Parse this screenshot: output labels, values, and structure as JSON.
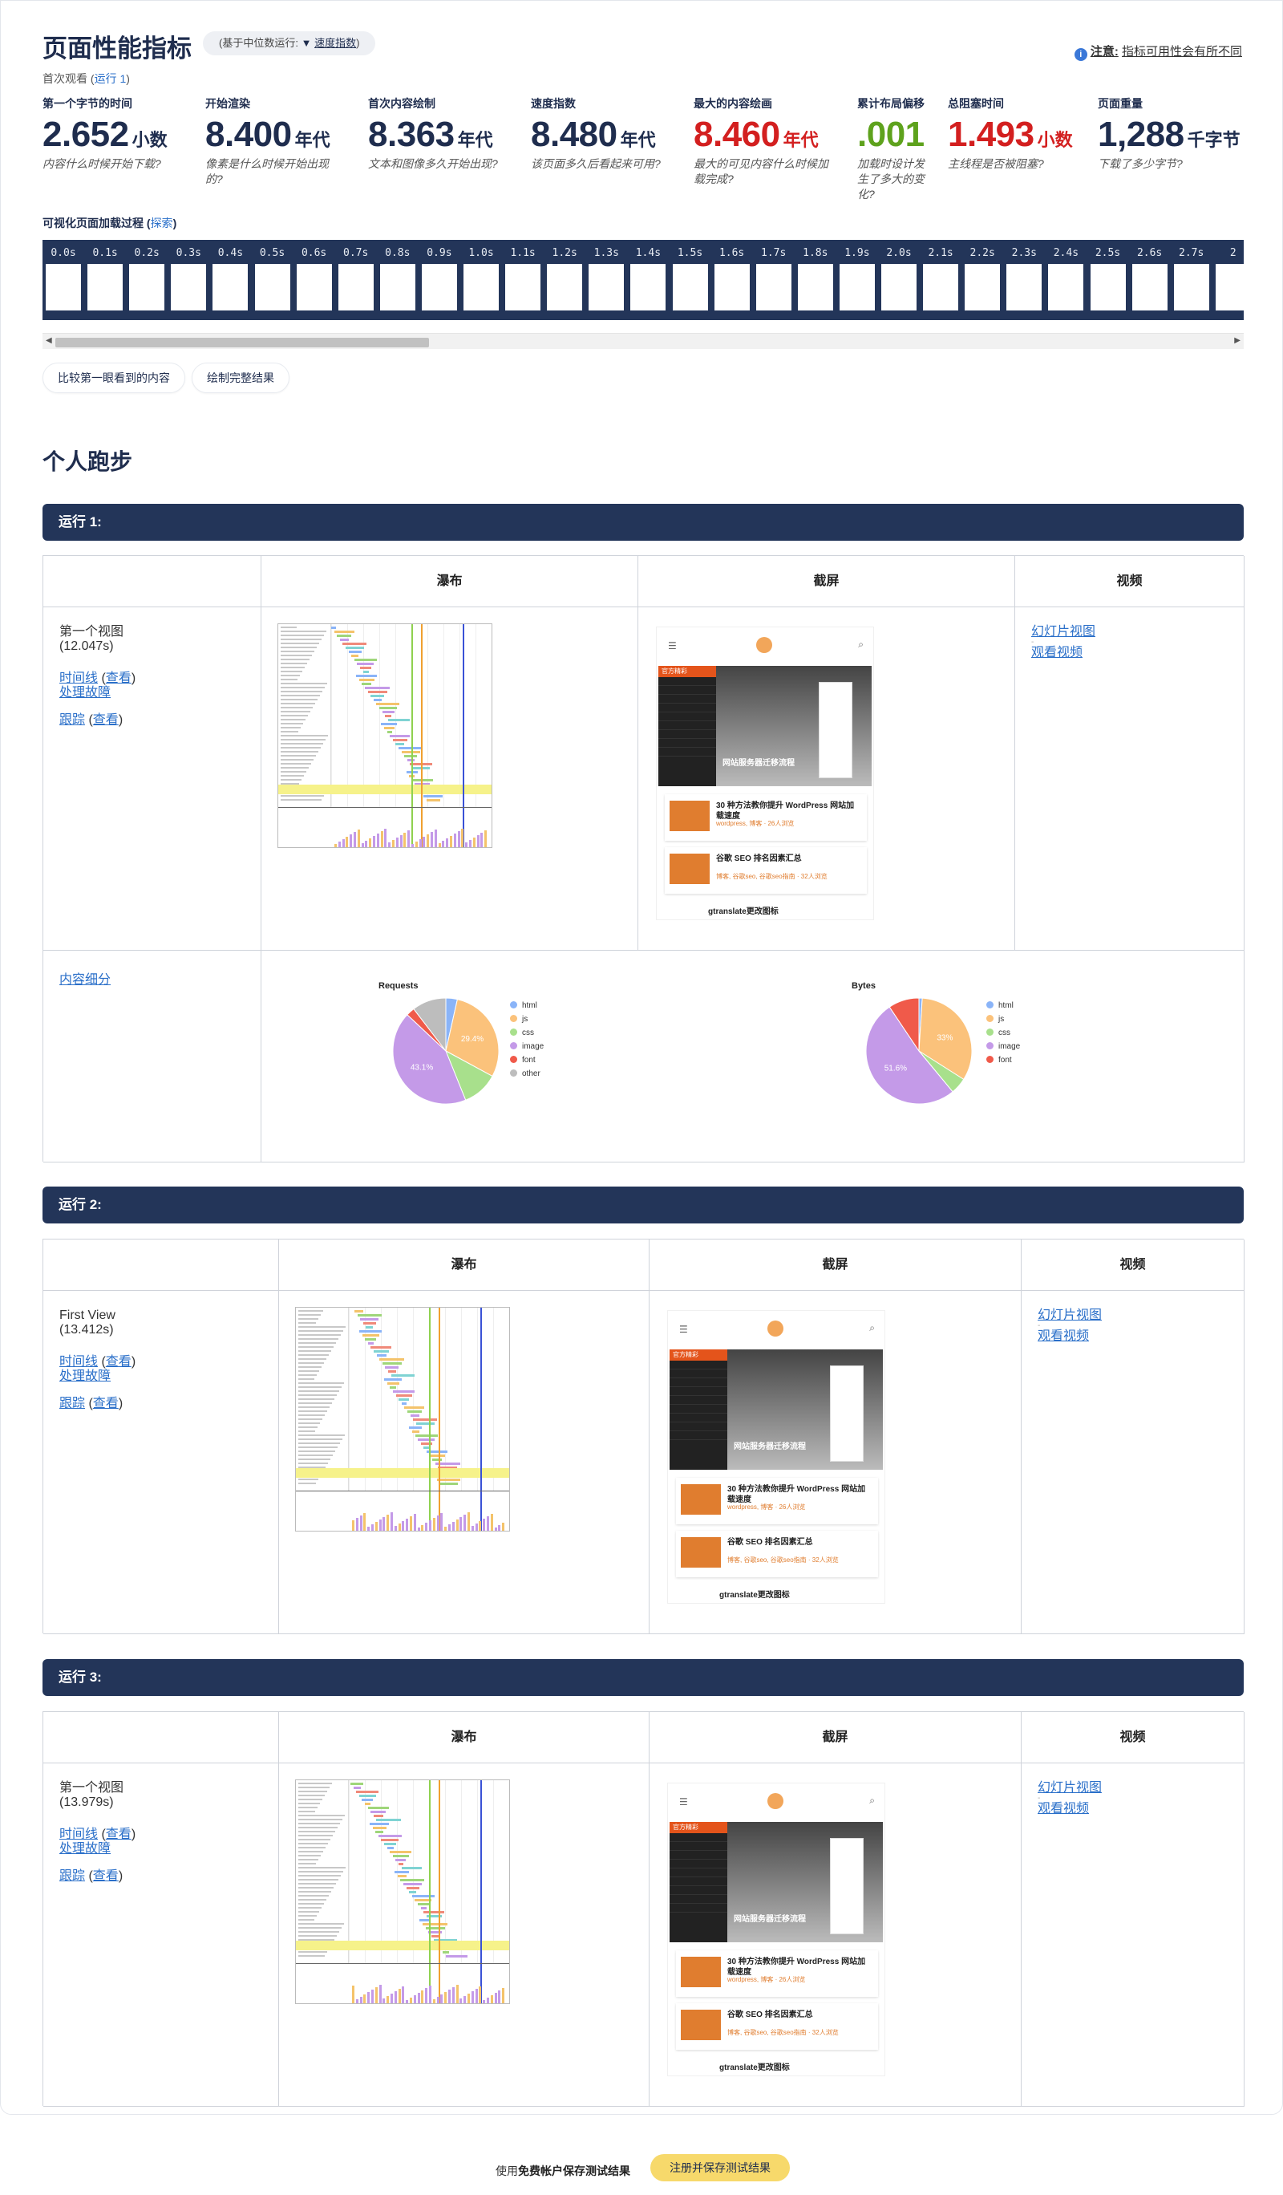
{
  "header": {
    "title": "页面性能指标",
    "median_prefix": "(基于中位数运行:",
    "median_caret": "▼",
    "median_value": "速度指数",
    "median_suffix": ")",
    "notice_icon": "info-icon",
    "notice_label": "注意:",
    "notice_text": "指标可用性会有所不同",
    "first_view_label": "首次观看",
    "first_view_run_open": "(",
    "first_view_run": "运行 1",
    "first_view_run_close": ")"
  },
  "metrics": [
    {
      "label": "第一个字节的时间",
      "value": "2.652",
      "unit": "小数",
      "desc": "内容什么时候开始下载?",
      "color": "#1f2d4e"
    },
    {
      "label": "开始渲染",
      "value": "8.400",
      "unit": "年代",
      "desc": "像素是什么时候开始出现的?",
      "color": "#1f2d4e"
    },
    {
      "label": "首次内容绘制",
      "value": "8.363",
      "unit": "年代",
      "desc": "文本和图像多久开始出现?",
      "color": "#1f2d4e"
    },
    {
      "label": "速度指数",
      "value": "8.480",
      "unit": "年代",
      "desc": "该页面多久后看起来可用?",
      "color": "#1f2d4e"
    },
    {
      "label": "最大的内容绘画",
      "value": "8.460",
      "unit": "年代",
      "desc": "最大的可见内容什么时候加载完成?",
      "color": "#d31f1f"
    },
    {
      "label": "累计布局偏移",
      "value": ".001",
      "unit": "",
      "desc": "加载时设计发生了多大的变化?",
      "color": "#5ea21d"
    },
    {
      "label": "总阻塞时间",
      "value": "1.493",
      "unit": "小数",
      "desc": "主线程是否被阻塞?",
      "color": "#d31f1f"
    },
    {
      "label": "页面重量",
      "value": "1,288",
      "unit": "千字节",
      "desc": "下载了多少字节?",
      "color": "#1f2d4e"
    }
  ],
  "filmstrip": {
    "title": "可视化页面加载过程",
    "explore_open": "(",
    "explore": "探索",
    "explore_close": ")",
    "times": [
      "0.0s",
      "0.1s",
      "0.2s",
      "0.3s",
      "0.4s",
      "0.5s",
      "0.6s",
      "0.7s",
      "0.8s",
      "0.9s",
      "1.0s",
      "1.1s",
      "1.2s",
      "1.3s",
      "1.4s",
      "1.5s",
      "1.6s",
      "1.7s",
      "1.8s",
      "1.9s",
      "2.0s",
      "2.1s",
      "2.2s",
      "2.3s",
      "2.4s",
      "2.5s",
      "2.6s",
      "2.7s",
      "2"
    ],
    "scroll_left": "◀",
    "scroll_right": "▶"
  },
  "buttons": {
    "compare": "比较第一眼看到的内容",
    "plot": "绘制完整结果"
  },
  "section_title": "个人跑步",
  "table_headers": {
    "waterfall": "瀑布",
    "screenshot": "截屏",
    "video": "视频"
  },
  "runs": [
    {
      "title": "运行 1:",
      "view_label": "第一个视图",
      "time": "(12.047s)",
      "timeline": "时间线",
      "view_open": "(",
      "view": "查看",
      "view_close": ")",
      "troubleshoot": "处理故障",
      "trace": "跟踪",
      "trace_view": "查看",
      "filmstrip_view": "幻灯片视图",
      "sep": "-",
      "watch_video": "观看视频"
    },
    {
      "title": "运行 2:",
      "view_label": "First View",
      "time": "(13.412s)",
      "timeline": "时间线",
      "view_open": "(",
      "view": "查看",
      "view_close": ")",
      "troubleshoot": "处理故障",
      "trace": "跟踪",
      "trace_view": "查看",
      "filmstrip_view": "幻灯片视图",
      "sep": "-",
      "watch_video": "观看视频"
    },
    {
      "title": "运行 3:",
      "view_label": "第一个视图",
      "time": "(13.979s)",
      "timeline": "时间线",
      "view_open": "(",
      "view": "查看",
      "view_close": ")",
      "troubleshoot": "处理故障",
      "trace": "跟踪",
      "trace_view": "查看",
      "filmstrip_view": "幻灯片视图",
      "sep": "-",
      "watch_video": "观看视频"
    }
  ],
  "screenshot_content": {
    "hot_label": "官方精彩",
    "hero_title": "网站服务器迁移流程",
    "post1_title": "30 种方法教你提升 WordPress 网站加载速度",
    "post1_meta": "wordpress, 博客  ·  26人浏览",
    "post2_title": "谷歌 SEO 排名因素汇总",
    "post2_meta": "博客, 谷歌seo, 谷歌seo指南  ·  32人浏览",
    "post3_title": "gtranslate更改图标"
  },
  "content_breakdown": {
    "link": "内容细分",
    "requests_title": "Requests",
    "bytes_title": "Bytes",
    "legend_requests": [
      "html",
      "js",
      "css",
      "image",
      "font",
      "other"
    ],
    "legend_bytes": [
      "html",
      "js",
      "css",
      "image",
      "font"
    ],
    "colors": {
      "html": "#8ab4f8",
      "js": "#fbc27b",
      "css": "#a8e08c",
      "image": "#c49ae8",
      "font": "#f05a4a",
      "other": "#bdbdbd"
    },
    "requests_share": {
      "html": 3.5,
      "js": 29.4,
      "css": 11.0,
      "image": 43.1,
      "font": 2.6,
      "other": 10.4
    },
    "bytes_share": {
      "html": 1.0,
      "js": 33.0,
      "css": 5.0,
      "image": 51.6,
      "font": 9.4
    },
    "requests_labels": [
      "29.4%",
      "43.1%"
    ],
    "bytes_labels": [
      "33%",
      "51.6%"
    ]
  },
  "footer": {
    "prefix": "使用",
    "bold": "免费帐户保存测试结果",
    "button": "注册并保存测试结果"
  }
}
